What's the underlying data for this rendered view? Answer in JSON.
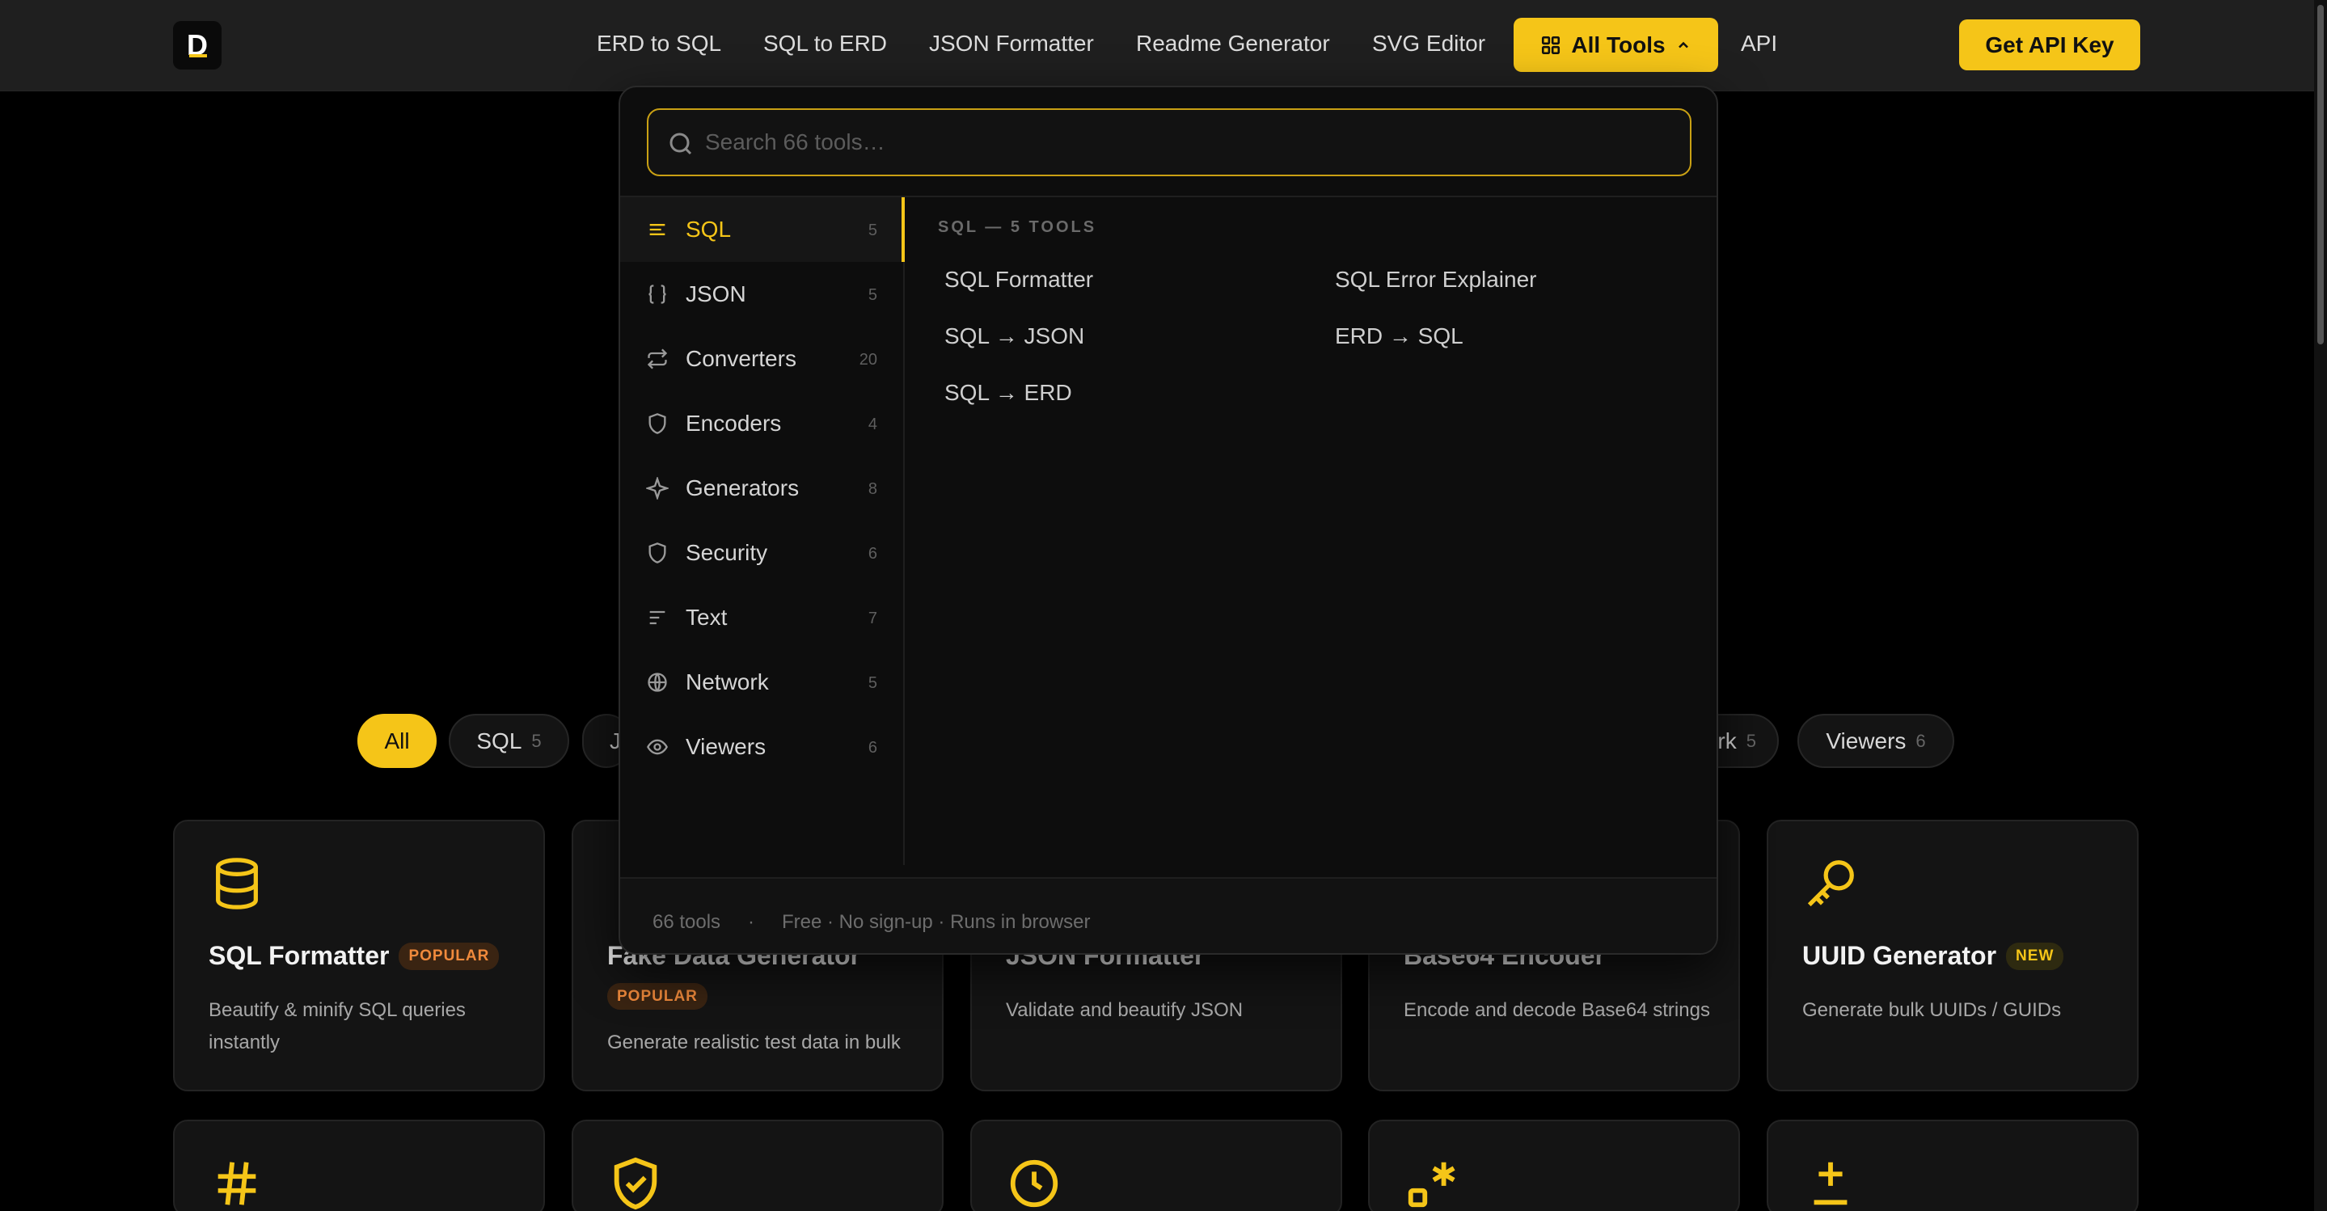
{
  "nav": {
    "logo_letter": "D",
    "links": [
      "ERD to SQL",
      "SQL to ERD",
      "JSON Formatter",
      "Readme Generator",
      "SVG Editor"
    ],
    "all_tools_label": "All Tools",
    "api_label": "API",
    "cta_label": "Get API Key",
    "accent": "#f5c518"
  },
  "search": {
    "placeholder": "Search 66 tools…"
  },
  "categories": [
    {
      "label": "SQL",
      "count": "5",
      "icon": "sql-lines-icon"
    },
    {
      "label": "JSON",
      "count": "5",
      "icon": "braces-icon"
    },
    {
      "label": "Converters",
      "count": "20",
      "icon": "repeat-arrows-icon"
    },
    {
      "label": "Encoders",
      "count": "4",
      "icon": "shield-icon"
    },
    {
      "label": "Generators",
      "count": "8",
      "icon": "sparkle-icon"
    },
    {
      "label": "Security",
      "count": "6",
      "icon": "shield-icon"
    },
    {
      "label": "Text",
      "count": "7",
      "icon": "text-lines-icon"
    },
    {
      "label": "Network",
      "count": "5",
      "icon": "globe-icon"
    },
    {
      "label": "Viewers",
      "count": "6",
      "icon": "eye-icon"
    }
  ],
  "panel": {
    "heading": "SQL — 5 TOOLS",
    "tools": [
      "SQL Formatter",
      "SQL Error Explainer",
      "SQL → JSON",
      "ERD → SQL",
      "SQL → ERD"
    ]
  },
  "dropdown_footer": {
    "count": "66 tools",
    "sep": "·",
    "note": "Free · No sign-up · Runs in browser"
  },
  "chips": [
    {
      "label": "All",
      "count": ""
    },
    {
      "label": "SQL",
      "count": "5"
    },
    {
      "label": "J",
      "count": ""
    },
    {
      "label": "rk",
      "count": "5"
    },
    {
      "label": "Viewers",
      "count": "6"
    }
  ],
  "cards": [
    {
      "title": "SQL Formatter",
      "badge": "POPULAR",
      "desc": "Beautify & minify SQL queries instantly",
      "icon": "database-icon"
    },
    {
      "title": "Fake Data Generator",
      "badge": "POPULAR",
      "desc": "Generate realistic test data in bulk",
      "icon": "dollar-icon"
    },
    {
      "title": "JSON Formatter",
      "badge": "",
      "desc": "Validate and beautify JSON",
      "icon": "braces-icon"
    },
    {
      "title": "Base64 Encoder",
      "badge": "",
      "desc": "Encode and decode Base64 strings",
      "icon": "code-icon"
    },
    {
      "title": "UUID Generator",
      "badge": "NEW",
      "desc": "Generate bulk UUIDs / GUIDs",
      "icon": "key-icon"
    }
  ],
  "row2_icons": [
    "hash-icon",
    "shield-check-icon",
    "clock-icon",
    "regex-icon",
    "plus-minus-icon"
  ]
}
